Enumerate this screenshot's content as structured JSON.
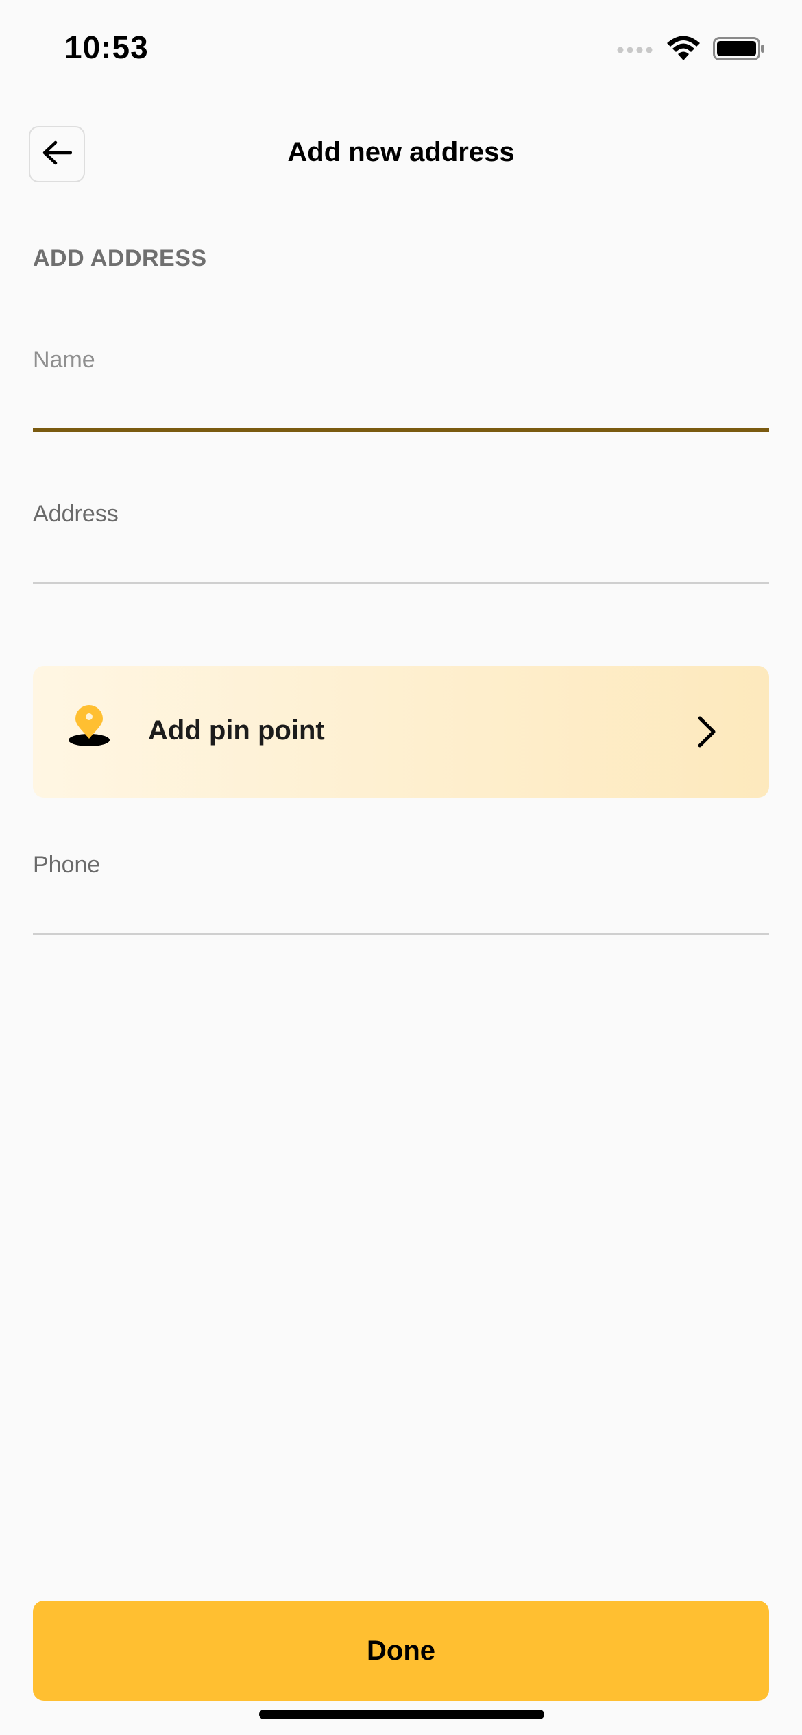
{
  "status_bar": {
    "time": "10:53"
  },
  "header": {
    "title": "Add new address",
    "back_icon": "arrow-left-icon"
  },
  "section": {
    "title": "ADD ADDRESS"
  },
  "form": {
    "name": {
      "label": "Name",
      "value": ""
    },
    "address": {
      "label": "Address",
      "value": ""
    },
    "phone": {
      "label": "Phone",
      "value": ""
    }
  },
  "pin_point": {
    "label": "Add pin point",
    "icon": "map-pin-icon",
    "chevron_icon": "chevron-right-icon"
  },
  "footer": {
    "done_label": "Done"
  },
  "colors": {
    "accent": "#ffbf31",
    "active_underline": "#7a5a10",
    "pin_yellow": "#ffbf31",
    "background": "#fafafa"
  }
}
